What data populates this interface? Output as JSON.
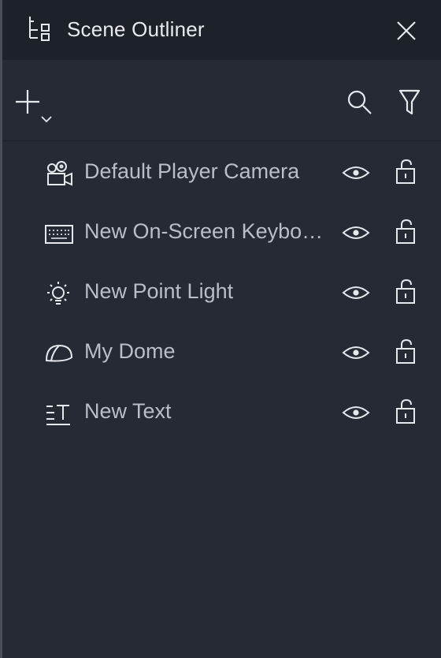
{
  "panel": {
    "title": "Scene Outliner",
    "icons": {
      "title": "outliner-icon",
      "close": "close-icon",
      "add": "plus-dropdown-icon",
      "search": "search-icon",
      "filter": "filter-icon"
    }
  },
  "items": [
    {
      "label": "Default Player Camera",
      "icon": "camera-icon"
    },
    {
      "label": "New On-Screen Keybo…",
      "icon": "keyboard-icon"
    },
    {
      "label": "New Point Light",
      "icon": "point-light-icon"
    },
    {
      "label": "My Dome",
      "icon": "dome-icon"
    },
    {
      "label": "New Text",
      "icon": "text-icon"
    }
  ],
  "colors": {
    "header_bg": "#1d212a",
    "panel_bg": "#252a35",
    "title_text": "#e8eaee",
    "item_text": "#b9bec9",
    "icon_stroke": "#e6e8ec"
  }
}
